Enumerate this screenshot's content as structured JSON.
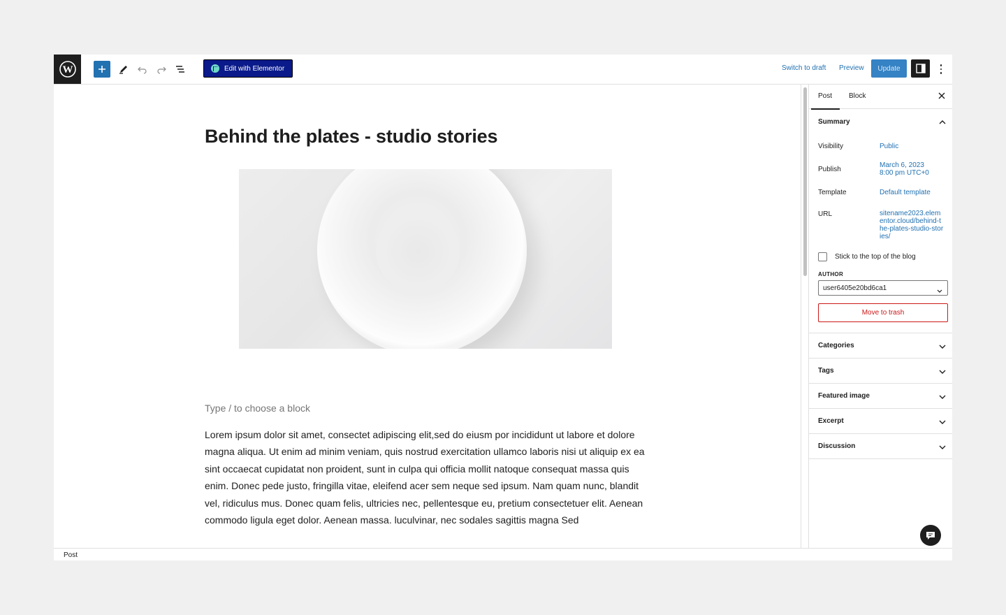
{
  "toolbar": {
    "elementor_label": "Edit with Elementor",
    "switch_to_draft": "Switch to draft",
    "preview": "Preview",
    "update": "Update"
  },
  "post": {
    "title": "Behind the plates - studio stories",
    "placeholder": "Type / to choose a block",
    "body": "Lorem ipsum dolor sit amet, consectet adipiscing elit,sed do eiusm por incididunt ut labore et dolore magna aliqua. Ut enim ad minim veniam, quis nostrud exercitation ullamco laboris nisi ut aliquip ex ea sint occaecat cupidatat non proident, sunt in culpa qui officia mollit natoque consequat massa quis enim. Donec pede justo, fringilla vitae, eleifend acer sem neque sed ipsum. Nam quam nunc, blandit vel, ridiculus mus. Donec quam felis, ultricies nec, pellentesque eu, pretium consectetuer  elit. Aenean commodo ligula eget dolor. Aenean massa. luculvinar,  nec sodales sagittis magna Sed"
  },
  "sidebar": {
    "tabs": [
      {
        "label": "Post"
      },
      {
        "label": "Block"
      }
    ],
    "summary": {
      "title": "Summary",
      "visibility_label": "Visibility",
      "visibility_value": "Public",
      "publish_label": "Publish",
      "publish_date": "March 6, 2023",
      "publish_time": "8:00 pm UTC+0",
      "template_label": "Template",
      "template_value": "Default template",
      "url_label": "URL",
      "url_value": "sitename2023.elementor.cloud/behind-the-plates-studio-stories/",
      "sticky_label": "Stick to the top of the blog",
      "author_label": "AUTHOR",
      "author_value": "user6405e20bd6ca1",
      "trash_label": "Move to trash"
    },
    "sections": [
      {
        "label": "Categories"
      },
      {
        "label": "Tags"
      },
      {
        "label": "Featured image"
      },
      {
        "label": "Excerpt"
      },
      {
        "label": "Discussion"
      }
    ]
  },
  "footer": {
    "breadcrumb": "Post"
  },
  "colors": {
    "accent": "#2271b1",
    "elementor": "#0a1a8a",
    "danger": "#cc1818"
  }
}
